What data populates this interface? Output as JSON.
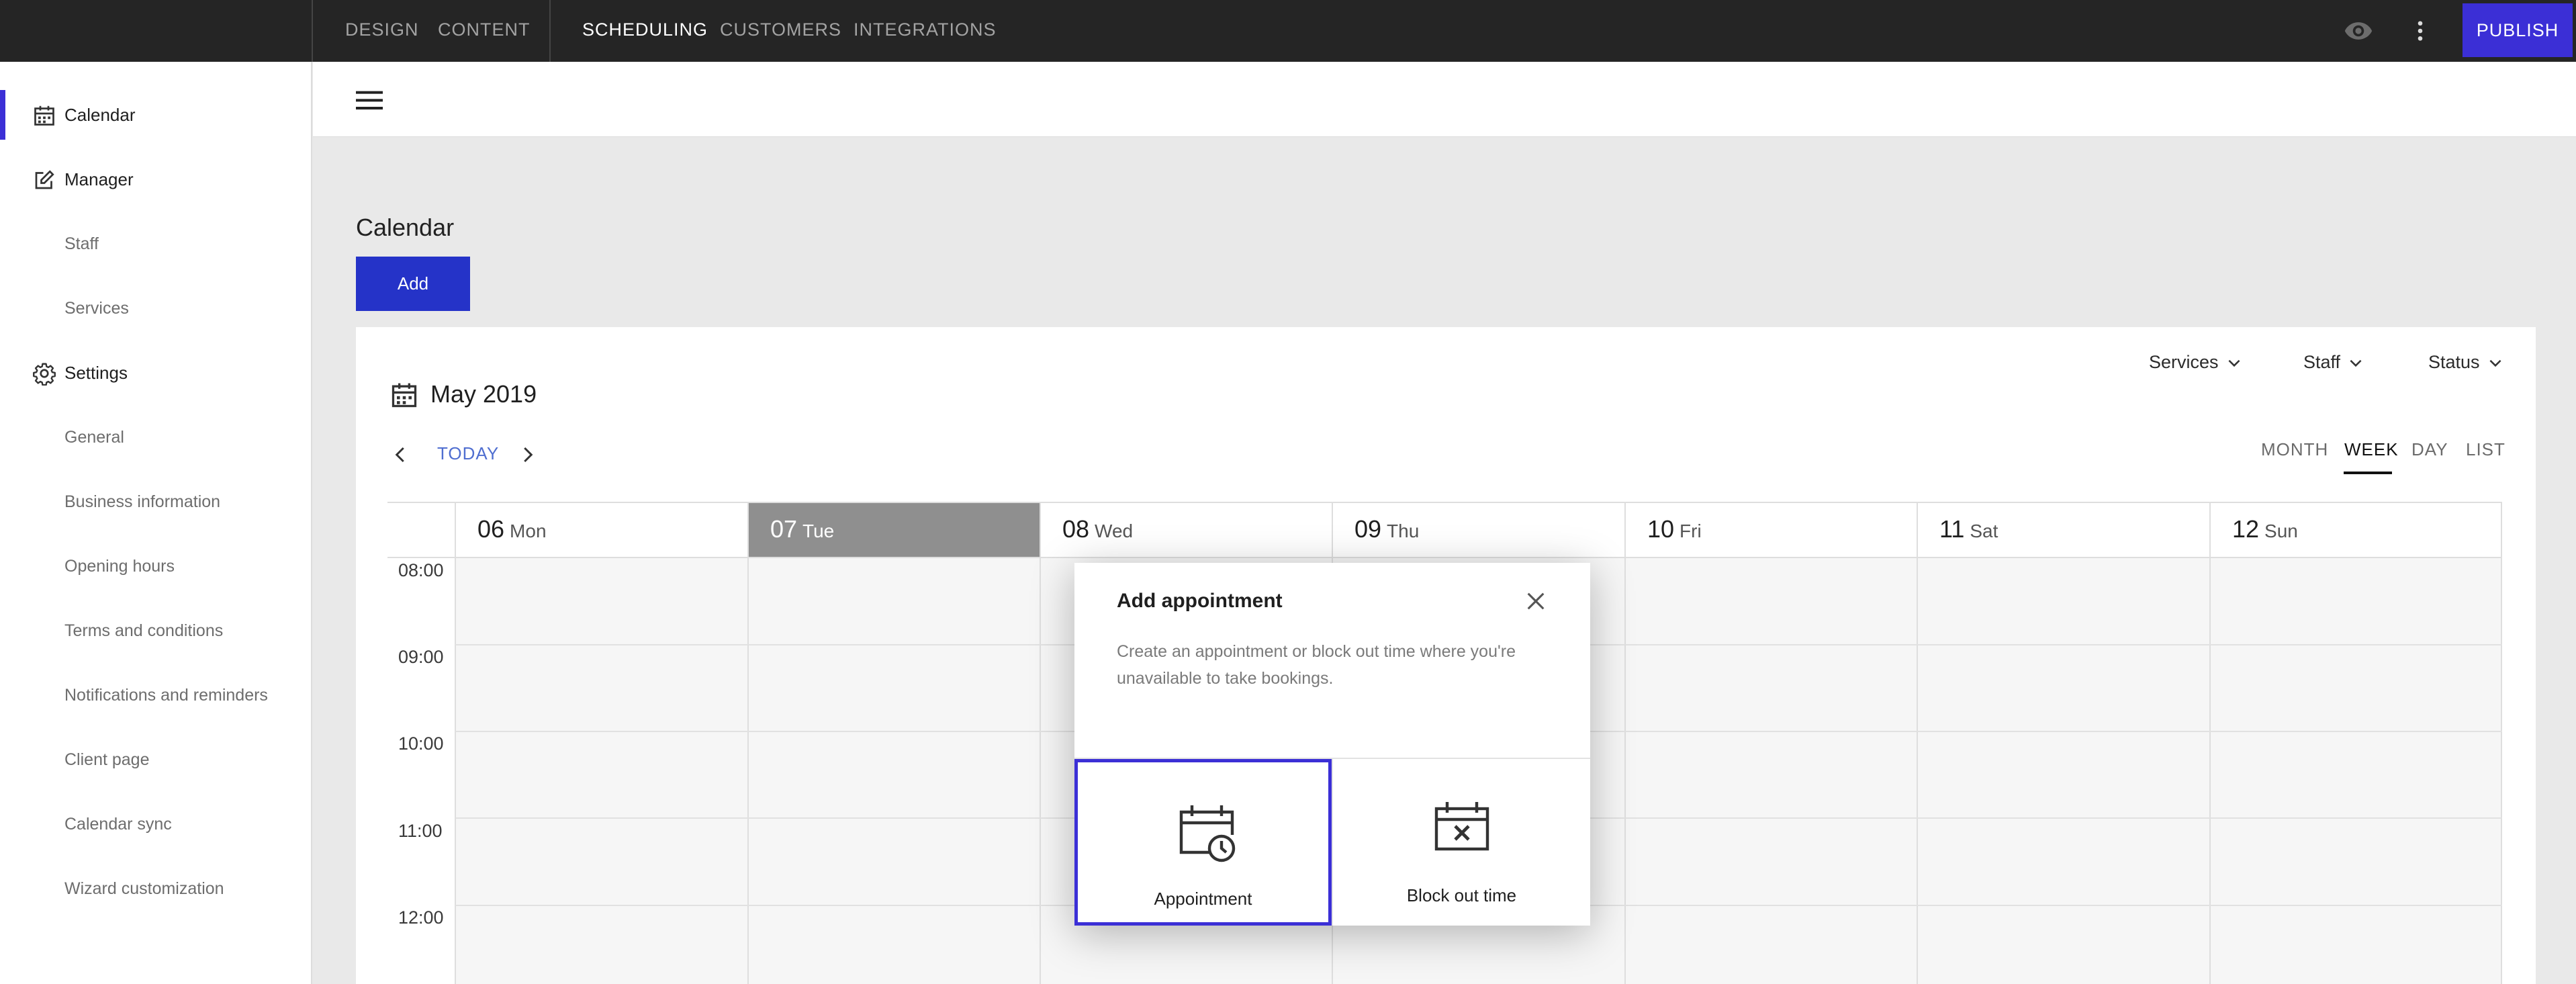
{
  "topbar": {
    "nav_group1": [
      "DESIGN",
      "CONTENT"
    ],
    "nav_group2": [
      "SCHEDULING",
      "CUSTOMERS",
      "INTEGRATIONS"
    ],
    "active": "SCHEDULING",
    "publish_label": "PUBLISH",
    "icons": [
      "eye-icon",
      "more-vertical-icon"
    ]
  },
  "sidebar": {
    "calendar": "Calendar",
    "manager": "Manager",
    "manager_items": [
      "Staff",
      "Services"
    ],
    "settings": "Settings",
    "settings_items": [
      "General",
      "Business information",
      "Opening hours",
      "Terms and conditions",
      "Notifications and reminders",
      "Client page",
      "Calendar sync",
      "Wizard customization"
    ]
  },
  "main": {
    "title": "Calendar",
    "add_label": "Add",
    "month": "May 2019",
    "today_label": "TODAY",
    "filters": [
      "Services",
      "Staff",
      "Status"
    ],
    "views": [
      "MONTH",
      "WEEK",
      "DAY",
      "LIST"
    ],
    "active_view": "WEEK",
    "days": [
      {
        "num": "06",
        "name": "Mon"
      },
      {
        "num": "07",
        "name": "Tue"
      },
      {
        "num": "08",
        "name": "Wed"
      },
      {
        "num": "09",
        "name": "Thu"
      },
      {
        "num": "10",
        "name": "Fri"
      },
      {
        "num": "11",
        "name": "Sat"
      },
      {
        "num": "12",
        "name": "Sun"
      }
    ],
    "selected_day": "07",
    "times": [
      "08:00",
      "09:00",
      "10:00",
      "11:00",
      "12:00"
    ]
  },
  "modal": {
    "title": "Add appointment",
    "description": "Create an appointment or block out time where you're unavailable to take bookings.",
    "options": [
      "Appointment",
      "Block out time"
    ],
    "selected_option": "Appointment"
  },
  "colors": {
    "accent": "#3b2fd6",
    "add_button": "#2533c8",
    "topbar_bg": "#252525",
    "selected_day_bg": "#8f8f8f",
    "today_link": "#4f6ed0"
  }
}
